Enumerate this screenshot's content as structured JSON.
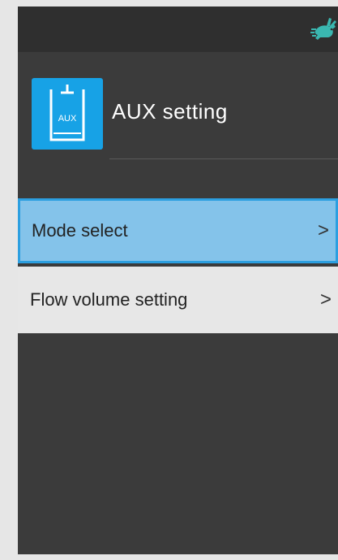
{
  "header": {
    "title": "AUX setting",
    "tile_label": "AUX",
    "tile_icon": "aux-connector-icon",
    "status_icon": "rabbit-fast-mode-icon"
  },
  "menu": {
    "items": [
      {
        "label": "Mode select",
        "chevron": ">",
        "selected": true
      },
      {
        "label": "Flow volume setting",
        "chevron": ">",
        "selected": false
      }
    ]
  },
  "colors": {
    "accent": "#17a2e6",
    "selected_bg": "#84c3ea",
    "selected_border": "#2c9fe0",
    "background": "#3b3b3b",
    "topbar": "#2f2f2f",
    "status_icon": "#3ab7b0"
  }
}
